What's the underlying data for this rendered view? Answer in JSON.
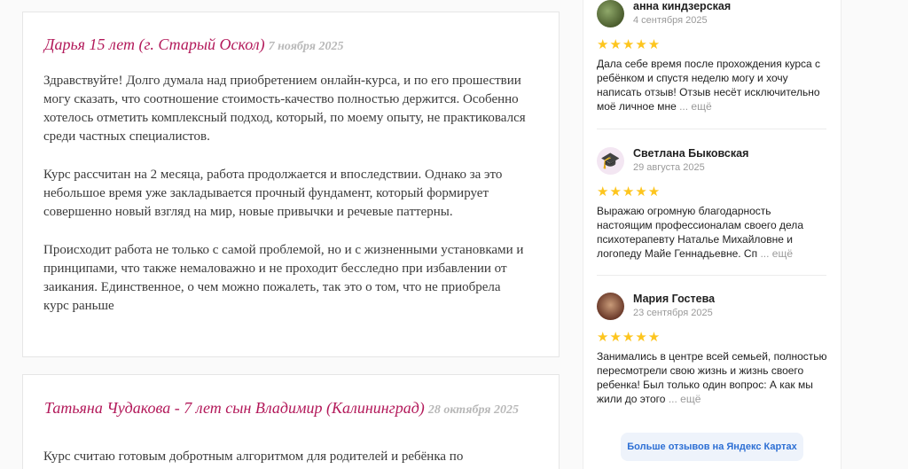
{
  "reviews": [
    {
      "name": "Дарья 15 лет (г. Старый Оскол)",
      "date": "7 ноября 2025",
      "paragraphs": [
        "Здравствуйте! Долго думала над приобретением онлайн-курса, и по его прошествии могу сказать, что соотношение стоимость-качество полностью держится. Особенно хотелось отметить комплексный подход, который, по моему опыту, не практиковался среди частных специалистов.",
        "Курс рассчитан на 2 месяца, работа продолжается и впоследствии. Однако за это небольшое время уже закладывается прочный фундамент, который формирует совершенно новый взгляд на мир, новые привычки и речевые паттерны.",
        "Происходит работа не только с самой проблемой, но и с жизненными установками и принципами, что также немаловажно и не проходит бесследно при избавлении от заикания. Единственное, о чем можно пожалеть, так это о том, что не приобрела курс раньше"
      ]
    },
    {
      "name": "Татьяна Чудакова - 7 лет сын Владимир (Калининград)",
      "date": "28 октября 2025",
      "paragraphs": [
        "Курс считаю готовым добротным алгоритмом для родителей и ребёнка по"
      ]
    }
  ],
  "yandex": {
    "stars": "★★★★★",
    "more_label": "... ещё",
    "items": [
      {
        "name": "анна киндзерская",
        "date": "4 сентября 2025",
        "rating": 5,
        "text": "Дала себе время после прохождения курса с ребёнком и спустя неделю могу и хочу написать отзыв! Отзыв несёт исключительно моё личное мне"
      },
      {
        "name": "Светлана Быковская",
        "date": "29 августа 2025",
        "rating": 5,
        "avatar_icon": "graduation-cap-icon",
        "avatar_glyph": "🎓",
        "text": "Выражаю огромную благодарность настоящим профессионалам своего дела психотерапевту Наталье Михайловне и логопеду Майе Геннадьевне. Сп"
      },
      {
        "name": "Мария Гостева",
        "date": "23 сентября 2025",
        "rating": 5,
        "text": "Занимались в центре всей семьей, полностью пересмотрели свою жизнь и жизнь своего ребенка! Был только один вопрос: А как мы жили до этого"
      }
    ],
    "button_label": "Больше отзывов на Яндекс Картах"
  },
  "colors": {
    "name_accent": "#b3195a",
    "star": "#fdc51e",
    "link_blue": "#2d6fd4"
  }
}
